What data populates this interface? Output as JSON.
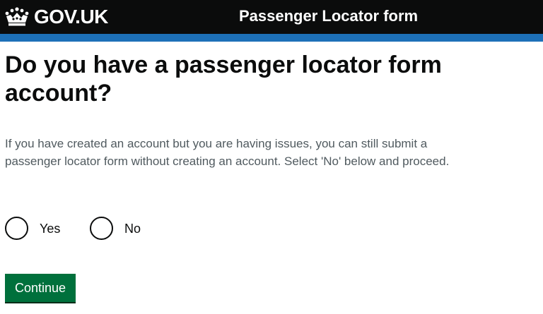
{
  "header": {
    "logo_text": "GOV.UK",
    "service_name": "Passenger Locator form",
    "colors": {
      "background": "#0b0c0c",
      "stripe": "#1d70b8"
    },
    "logo_icon": "crown-icon"
  },
  "main": {
    "title": "Do you have a passenger locator form account?",
    "hint": "If you have created an account but you are having issues, you can still submit a passenger locator form without creating an account. Select 'No' below and proceed.",
    "options": [
      {
        "label": "Yes",
        "selected": false
      },
      {
        "label": "No",
        "selected": false
      }
    ],
    "continue_label": "Continue",
    "colors": {
      "button": "#00703c",
      "hint_text": "#505a5f"
    }
  }
}
